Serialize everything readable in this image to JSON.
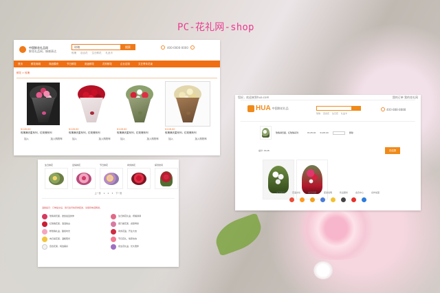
{
  "hero": {
    "title": "PC-花礼网-shop"
  },
  "panel1": {
    "brand_name": "中国鲜花礼品网",
    "brand_sub": "鲜花礼品网，情感表达",
    "search_value": "玫瑰",
    "search_button": "搜索",
    "hot_words": [
      "玫瑰",
      "百合花",
      "生日鲜花",
      "礼品卡"
    ],
    "hotline": "400-0000-0000",
    "nav_items": [
      "首页",
      "鲜花商城",
      "商品模块",
      "节日鲜花",
      "用途鲜花",
      "花材鲜花",
      "企业定制",
      "文艺青年花束"
    ],
    "breadcrumb": "鲜花 > 玫瑰",
    "products": [
      {
        "price": "¥128.00",
        "name": "玫瑰满天星系列，红玫瑰系列",
        "add_label": "加入",
        "collect_label": "加入购物车"
      },
      {
        "price": "¥128.00",
        "name": "玫瑰满天星系列，红玫瑰系列",
        "add_label": "加入",
        "collect_label": "加入购物车"
      },
      {
        "price": "¥128.00",
        "name": "玫瑰满天星系列，红玫瑰系列",
        "add_label": "加入",
        "collect_label": "加入购物车"
      },
      {
        "price": "¥128.00",
        "name": "玫瑰满天星系列，红玫瑰系列",
        "add_label": "加入",
        "collect_label": "加入购物车"
      }
    ]
  },
  "panel2": {
    "top_left": "您好，欢迎来到hua.com",
    "top_right": "我的订单  我的花礼网",
    "logo_word": "HUA",
    "logo_sub": "中国鲜花礼品",
    "phone": "400-888-8888",
    "hot_words": [
      "玫瑰",
      "百合花",
      "生日花",
      "礼品卡"
    ],
    "cart": {
      "name": "玫瑰满天星，红玫瑰系列",
      "unit_price": "¥128.00",
      "subtotal": "¥128.00",
      "quantity": "1",
      "action": "删除"
    },
    "total_label": "总计: ¥128",
    "checkout_button": "去结算",
    "footer_links": [
      "关于我们",
      "花语文化",
      "常见问题",
      "配送说明",
      "售后服务",
      "会员中心",
      "合作加盟"
    ],
    "brand_color": "#f08a19"
  },
  "panel3": {
    "cards": [
      {
        "label": "生日鲜花"
      },
      {
        "label": "爱情鲜花"
      },
      {
        "label": "节日鲜花"
      },
      {
        "label": "商务鲜花"
      },
      {
        "label": "探望慰问"
      }
    ],
    "pager": [
      "上一页",
      "1",
      "2",
      "3",
      "下一页"
    ],
    "notice": "温馨提示：订单提交后，我们会尽快安排配送，请保持电话畅通。",
    "list_left": [
      "玫瑰满天星，送给最爱的你",
      "红玫瑰花束，浪漫告白",
      "粉玫瑰礼盒，甜蜜时光",
      "向日葵花束，温暖阳光",
      "百合花束，纯洁美好"
    ],
    "list_right": [
      "生日鲜花礼盒，祝福满满",
      "康乃馨花束，感恩母亲",
      "商务花篮，开业大吉",
      "节日花礼，情意浓浓",
      "永生花礼盒，长久陪伴"
    ]
  }
}
